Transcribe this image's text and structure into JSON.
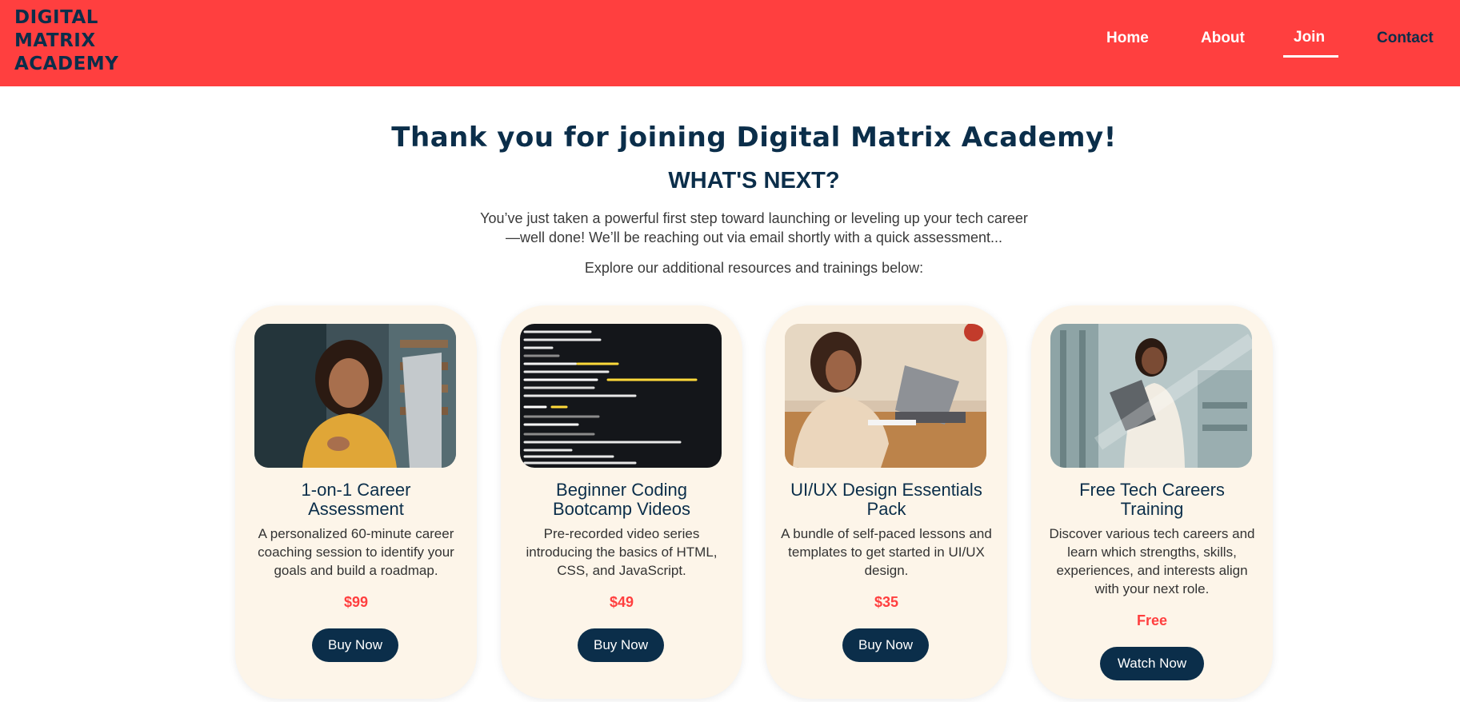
{
  "brand": {
    "logo_lines": [
      "DIGITAL",
      "MATRIX",
      "ACADEMY"
    ]
  },
  "nav": {
    "items": [
      {
        "label": "Home"
      },
      {
        "label": "About"
      },
      {
        "label": "Join"
      },
      {
        "label": "Contact"
      }
    ],
    "active": "Join"
  },
  "main": {
    "title": "Thank you for joining Digital Matrix Academy!",
    "subtitle": "WHAT'S NEXT?",
    "intro_lines": [
      "You’ve just taken a powerful first step toward launching or leveling up your tech career",
      "—well done! We’ll be reaching out via email shortly with a quick assessment..."
    ],
    "explore": "Explore our additional resources and trainings below:"
  },
  "cards": [
    {
      "title_lines": [
        "1-on-1 Career",
        "Assessment"
      ],
      "description": "A personalized 60-minute career coaching session to identify your goals and build a roadmap.",
      "price": "$99",
      "button": "Buy Now"
    },
    {
      "title_lines": [
        "Beginner Coding",
        "Bootcamp Videos"
      ],
      "description": "Pre-recorded video series introducing the basics of HTML, CSS, and JavaScript.",
      "price": "$49",
      "button": "Buy Now"
    },
    {
      "title_lines": [
        "UI/UX Design Essentials",
        "Pack"
      ],
      "description": "A bundle of self-paced lessons and templates to get started in UI/UX design.",
      "price": "$35",
      "button": "Buy Now"
    },
    {
      "title_lines": [
        "Free Tech Careers",
        "Training"
      ],
      "description": "Discover various tech careers and learn which strengths, skills, experiences, and interests align with your next role.",
      "price": "Free",
      "button": "Watch Now"
    }
  ],
  "colors": {
    "header_bg": "#ff3f3f",
    "navy": "#0b2e4a",
    "card_bg": "#fdf5e9",
    "price": "#ff3f3f"
  }
}
